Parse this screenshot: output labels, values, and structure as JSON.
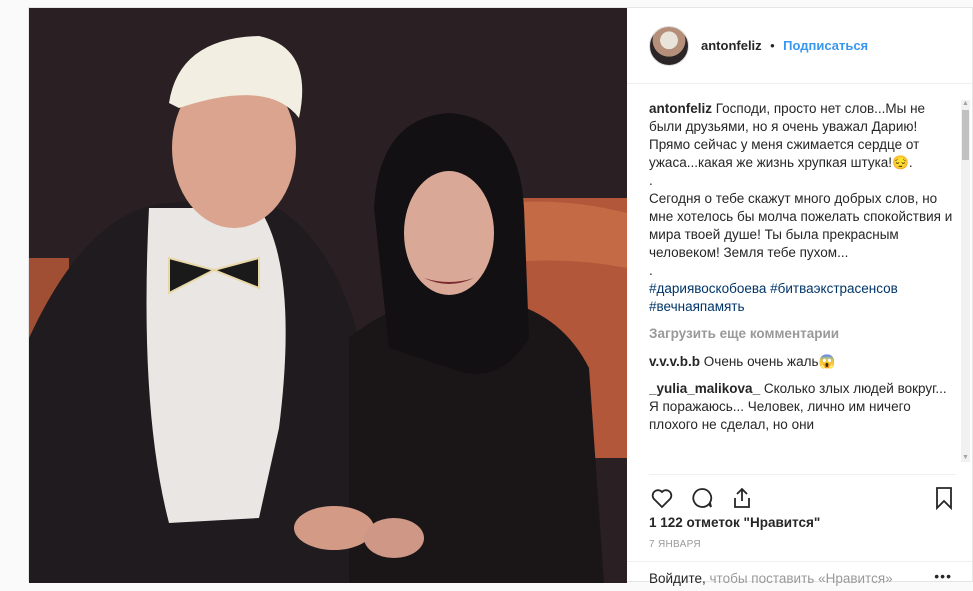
{
  "header": {
    "username": "antonfeliz",
    "separator": "•",
    "follow": "Подписаться"
  },
  "caption": {
    "username": "antonfeliz",
    "text1": "Господи, просто нет слов...Мы не были друзьями, но я очень уважал Дарию! Прямо сейчас у меня сжимается сердце от ужаса...какая же жизнь хрупкая штука!😔.",
    "dot1": ".",
    "text2": "Сегодня о тебе скажут много добрых слов, но мне хотелось бы молча пожелать спокойствия и мира твоей душе! Ты была прекрасным человеком! Земля тебе пухом...",
    "dot2": ".",
    "tags": "#дариявоскобоева #битваэкстрасенсов #вечнаяпамять"
  },
  "load_more": "Загрузить еще комментарии",
  "comments": [
    {
      "user": "v.v.v.b.b",
      "text": "Очень очень жаль😱"
    },
    {
      "user": "_yulia_malikova_",
      "text": "Сколько злых людей вокруг... Я поражаюсь... Человек, лично им ничего плохого не сделал, но они"
    }
  ],
  "likes": "1 122 отметок \"Нравится\"",
  "date": "7 ЯНВАРЯ",
  "add_comment": {
    "login": "Войдите,",
    "rest": " чтобы поставить «Нравится»"
  },
  "icons": {
    "like": "heart-icon",
    "comment": "comment-icon",
    "share": "share-icon",
    "save": "bookmark-icon",
    "options": "more-icon"
  }
}
